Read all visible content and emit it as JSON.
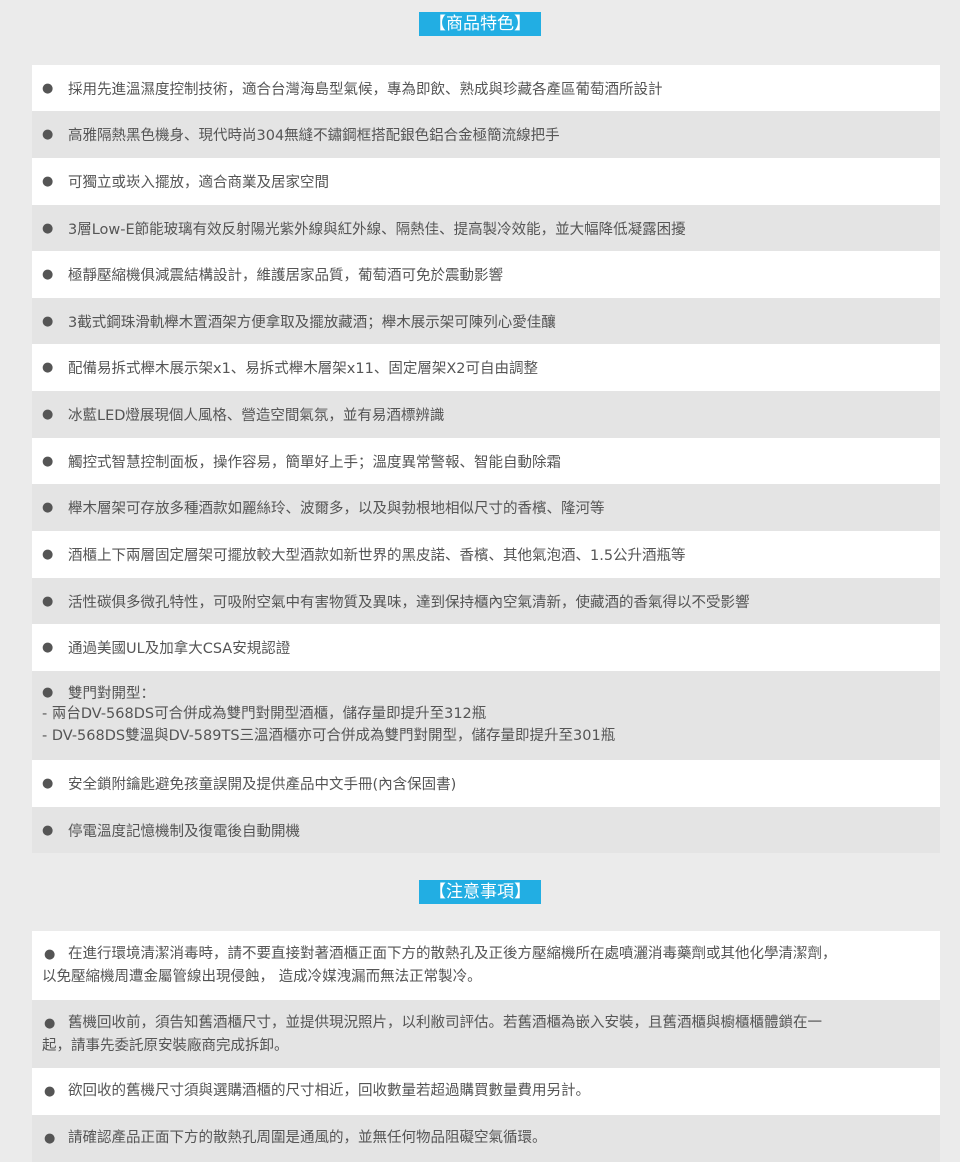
{
  "features": {
    "title": "【商品特色】",
    "items": [
      "採用先進溫濕度控制技術，適合台灣海島型氣候，專為即飲、熟成與珍藏各產區葡萄酒所設計",
      "高雅隔熱黑色機身、現代時尚304無縫不鏽鋼框搭配銀色鋁合金極簡流線把手",
      "可獨立或崁入擺放，適合商業及居家空間",
      "3層Low-E節能玻璃有效反射陽光紫外線與紅外線、隔熱佳、提高製冷效能，並大幅降低凝露困擾",
      "極靜壓縮機俱減震結構設計，維護居家品質，葡萄酒可免於震動影響",
      "3截式鋼珠滑軌櫸木置酒架方便拿取及擺放藏酒；櫸木展示架可陳列心愛佳釀",
      "配備易拆式櫸木展示架x1、易拆式櫸木層架x11、固定層架X2可自由調整",
      "冰藍LED燈展現個人風格、營造空間氣氛，並有易酒標辨識",
      "觸控式智慧控制面板，操作容易，簡單好上手；溫度異常警報、智能自動除霜",
      "櫸木層架可存放多種酒款如麗絲玲、波爾多，以及與勃根地相似尺寸的香檳、隆河等",
      "酒櫃上下兩層固定層架可擺放較大型酒款如新世界的黑皮諾、香檳、其他氣泡酒、1.5公升酒瓶等",
      "活性碳俱多微孔特性，可吸附空氣中有害物質及異味，達到保持櫃內空氣清新，使藏酒的香氣得以不受影響",
      "通過美國UL及加拿大CSA安規認證"
    ],
    "double_door": {
      "label": "雙門對開型：",
      "line1": "- 兩台DV-568DS可合併成為雙門對開型酒櫃，儲存量即提升至312瓶",
      "line2": "- DV-568DS雙溫與DV-589TS三溫酒櫃亦可合併成為雙門對開型，儲存量即提升至301瓶"
    },
    "items_after": [
      "安全鎖附鑰匙避免孩童誤開及提供產品中文手冊(內含保固書)",
      "停電溫度記憶機制及復電後自動開機"
    ]
  },
  "notes": {
    "title": "【注意事項】",
    "items": [
      {
        "line1": "在進行環境清潔消毒時，請不要直接對著酒櫃正面下方的散熱孔及正後方壓縮機所在處噴灑消毒藥劑或其他化學清潔劑，",
        "line2": "以免壓縮機周遭金屬管線出現侵蝕， 造成冷媒洩漏而無法正常製冷。"
      },
      {
        "line1": "舊機回收前，須告知舊酒櫃尺寸，並提供現況照片，以利敝司評估。若舊酒櫃為嵌入安裝，且舊酒櫃與櫥櫃櫃體鎖在一",
        "line2": "起，請事先委託原安裝廠商完成拆卸。"
      },
      {
        "line1": "欲回收的舊機尺寸須與選購酒櫃的尺寸相近，回收數量若超過購買數量費用另計。",
        "line2": ""
      },
      {
        "line1": "請確認產品正面下方的散熱孔周圍是通風的，並無任何物品阻礙空氣循環。",
        "line2": ""
      }
    ]
  },
  "bullet": "●"
}
